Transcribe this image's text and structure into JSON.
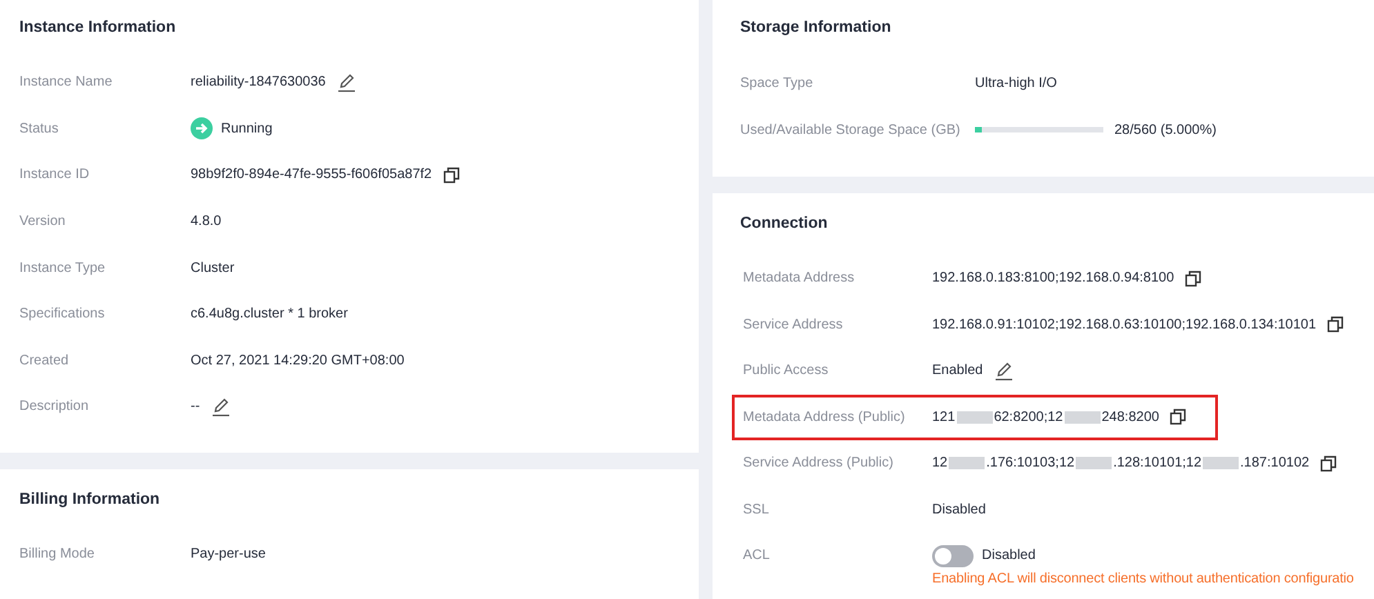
{
  "instance": {
    "title": "Instance Information",
    "rows": [
      {
        "label": "Instance Name",
        "value": "reliability-1847630036",
        "kind": "edit"
      },
      {
        "label": "Status",
        "value": "Running",
        "kind": "status"
      },
      {
        "label": "Instance ID",
        "value": "98b9f2f0-894e-47fe-9555-f606f05a87f2",
        "kind": "copy"
      },
      {
        "label": "Version",
        "value": "4.8.0",
        "kind": "plain"
      },
      {
        "label": "Instance Type",
        "value": "Cluster",
        "kind": "plain"
      },
      {
        "label": "Specifications",
        "value": "c6.4u8g.cluster * 1 broker",
        "kind": "plain"
      },
      {
        "label": "Created",
        "value": "Oct 27, 2021 14:29:20 GMT+08:00",
        "kind": "plain"
      },
      {
        "label": "Description",
        "value": "--",
        "kind": "edit"
      }
    ]
  },
  "billing": {
    "title": "Billing Information",
    "rows": [
      {
        "label": "Billing Mode",
        "value": "Pay-per-use",
        "kind": "plain"
      }
    ]
  },
  "storage": {
    "title": "Storage Information",
    "rows": [
      {
        "label": "Space Type",
        "value": "Ultra-high I/O",
        "kind": "plain"
      },
      {
        "label": "Used/Available Storage Space (GB)",
        "value": "28/560 (5.000%)",
        "kind": "meter",
        "level": 0.05
      }
    ]
  },
  "connection": {
    "title": "Connection",
    "rows": [
      {
        "label": "Metadata Address",
        "kind": "copy",
        "highlighted": false,
        "parts": [
          {
            "kind": "text",
            "text": "192.168.0.183:8100;192.168.0.94:8100"
          }
        ]
      },
      {
        "label": "Service Address",
        "kind": "copy",
        "highlighted": false,
        "parts": [
          {
            "kind": "text",
            "text": "192.168.0.91:10102;192.168.0.63:10100;192.168.0.134:10101"
          }
        ]
      },
      {
        "label": "Public Access",
        "kind": "edit",
        "highlighted": false,
        "parts": [
          {
            "kind": "text",
            "text": "Enabled"
          }
        ]
      },
      {
        "label": "Metadata Address (Public)",
        "kind": "copy",
        "highlighted": true,
        "parts": [
          {
            "kind": "text",
            "text": "121"
          },
          {
            "kind": "blur"
          },
          {
            "kind": "text",
            "text": "62:8200;12"
          },
          {
            "kind": "blur"
          },
          {
            "kind": "text",
            "text": "248:8200"
          }
        ]
      },
      {
        "label": "Service Address (Public)",
        "kind": "copy",
        "highlighted": false,
        "parts": [
          {
            "kind": "text",
            "text": "12"
          },
          {
            "kind": "blur"
          },
          {
            "kind": "text",
            "text": ".176:10103;12"
          },
          {
            "kind": "blur"
          },
          {
            "kind": "text",
            "text": ".128:10101;12"
          },
          {
            "kind": "blur"
          },
          {
            "kind": "text",
            "text": ".187:10102"
          }
        ]
      },
      {
        "label": "SSL",
        "kind": "plain",
        "highlighted": false,
        "parts": [
          {
            "kind": "text",
            "text": "Disabled"
          }
        ]
      },
      {
        "label": "ACL",
        "kind": "toggle",
        "on": false,
        "highlighted": false,
        "parts": [
          {
            "kind": "text",
            "text": "Disabled"
          }
        ],
        "note": "Enabling ACL will disconnect clients without authentication configuratio"
      }
    ]
  }
}
